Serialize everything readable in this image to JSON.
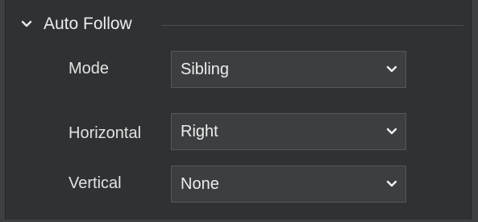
{
  "section": {
    "title": "Auto Follow",
    "expanded": true,
    "icon": "chevron-down-icon"
  },
  "fields": {
    "mode": {
      "label": "Mode",
      "value": "Sibling"
    },
    "horizontal": {
      "label": "Horizontal",
      "value": "Right"
    },
    "vertical": {
      "label": "Vertical",
      "value": "None"
    }
  },
  "colors": {
    "panel_background": "#2f3133",
    "field_background": "#3c3e40",
    "field_border": "#545658",
    "text": "#e6e6e6"
  }
}
